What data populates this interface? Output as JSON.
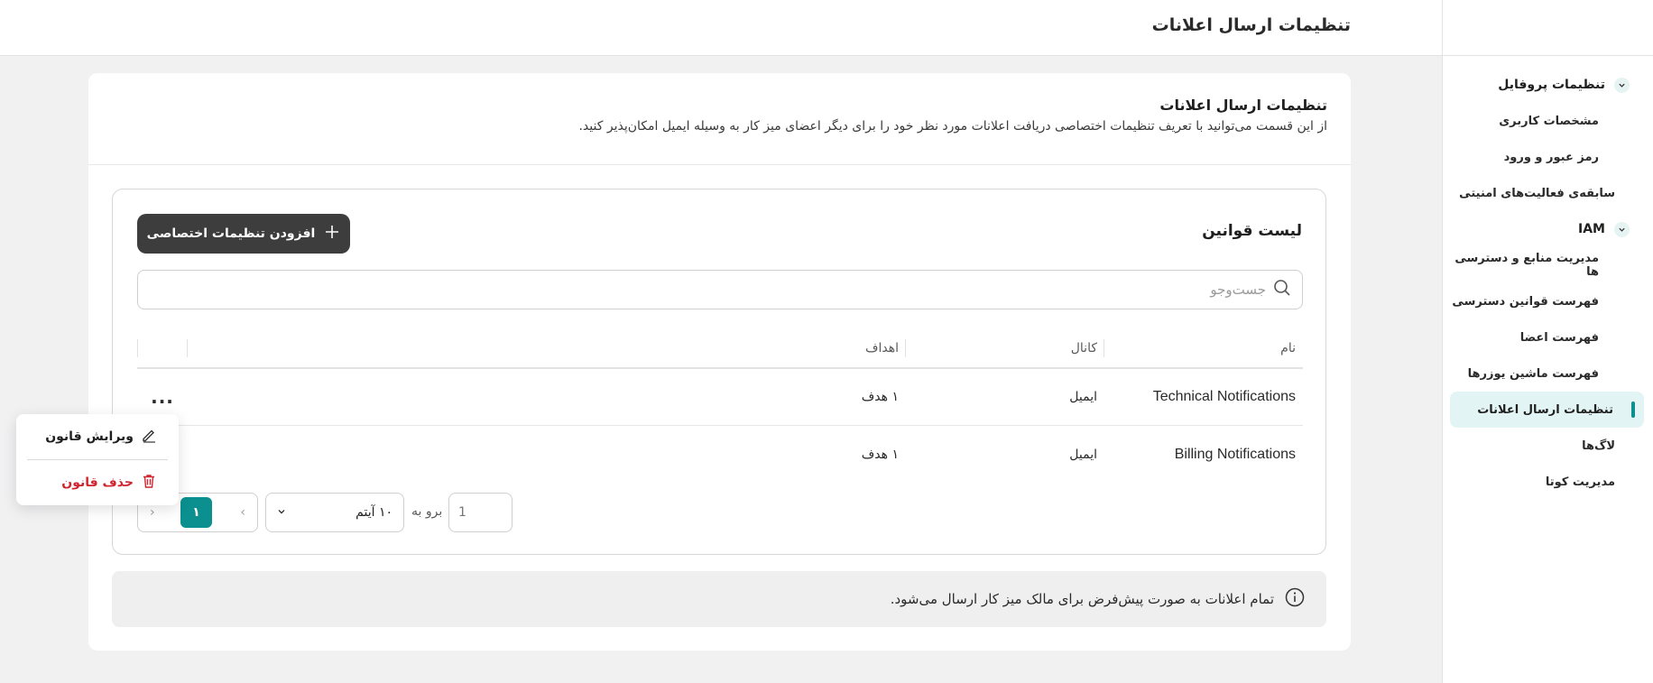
{
  "header": {
    "title": "تنظیمات ارسال اعلانات"
  },
  "sidebar": {
    "groups": [
      {
        "label": "تنظیمات پروفایل",
        "items": [
          "مشخصات کاربری",
          "رمز عبور و ورود",
          "سابقه‌ی فعالیت‌های امنیتی"
        ]
      },
      {
        "label": "IAM",
        "items": [
          "مدیریت منابع و دسترسی ها",
          "فهرست قوانین دسترسی",
          "فهرست اعضا",
          "فهرست ماشین یوزرها"
        ]
      }
    ],
    "items": [
      "تنظیمات ارسال اعلانات",
      "لاگ‌ها",
      "مدیریت کوتا"
    ],
    "active": "تنظیمات ارسال اعلانات"
  },
  "card": {
    "title": "تنظیمات ارسال اعلانات",
    "description": "از این قسمت می‌توانید با تعریف تنظیمات اختصاصی دریافت اعلانات مورد نظر خود را برای دیگر اعضای میز کار به وسیله ایمیل امکان‌پذیر کنید."
  },
  "rules": {
    "title": "لیست قوانین",
    "add_button": "افزودن تنظیمات اختصاصی",
    "search_placeholder": "جست‌وجو",
    "columns": {
      "name": "نام",
      "channel": "کانال",
      "targets": "اهداف"
    },
    "rows": [
      {
        "name": "Technical Notifications",
        "channel": "ایمیل",
        "targets": "۱ هدف"
      },
      {
        "name": "Billing Notifications",
        "channel": "ایمیل",
        "targets": "۱ هدف"
      }
    ],
    "row_actions": "..."
  },
  "pagination": {
    "prev": "‹",
    "next": "›",
    "current_page": "۱",
    "page_size": "۱۰ آیتم",
    "goto_label": "برو به",
    "goto_placeholder": "1"
  },
  "context_menu": {
    "edit": "ویرایش قانون",
    "delete": "حذف قانون"
  },
  "info": {
    "text": "تمام اعلانات به صورت پیش‌فرض برای مالک میز کار ارسال می‌شود."
  },
  "colors": {
    "accent": "#0b8f8f",
    "danger": "#d0242f",
    "button_dark": "#3d3d3d"
  },
  "icons": [
    "chevron-down-icon",
    "plus-icon",
    "search-icon",
    "more-icon",
    "edit-icon",
    "trash-icon",
    "info-icon"
  ]
}
